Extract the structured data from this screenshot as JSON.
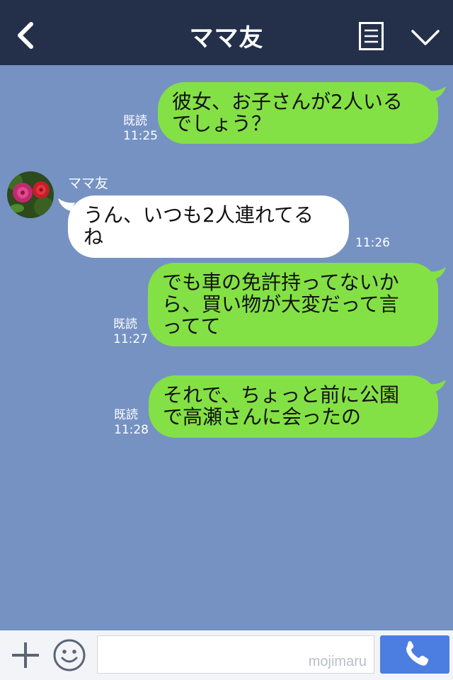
{
  "header": {
    "title": "ママ友",
    "back_icon": "chevron-left-icon",
    "menu_icon": "notes-icon",
    "expand_icon": "chevron-down-icon",
    "background": "#24304a"
  },
  "chat": {
    "background": "#7592c3",
    "outgoing_color": "#84e145",
    "incoming_color": "#ffffff",
    "messages": [
      {
        "direction": "out",
        "lines": [
          "彼女、お子さんが2人いる",
          "でしょう？"
        ],
        "read": "既読",
        "time": "11:25"
      },
      {
        "direction": "in",
        "sender": "ママ友",
        "lines": [
          "うん、いつも2人連れてる",
          "ね"
        ],
        "time": "11:26"
      },
      {
        "direction": "out",
        "lines": [
          "でも車の免許持ってないか",
          "ら、買い物が大変だって言",
          "ってて"
        ],
        "read": "既読",
        "time": "11:27"
      },
      {
        "direction": "out",
        "lines": [
          "それで、ちょっと前に公園",
          "で高瀬さんに会ったの"
        ],
        "read": "既読",
        "time": "11:28"
      }
    ]
  },
  "footer": {
    "plus_icon": "plus-icon",
    "emoji_icon": "smiley-icon",
    "input_value": "",
    "watermark": "mojimaru",
    "call_icon": "phone-icon",
    "call_color": "#4c7de0"
  }
}
